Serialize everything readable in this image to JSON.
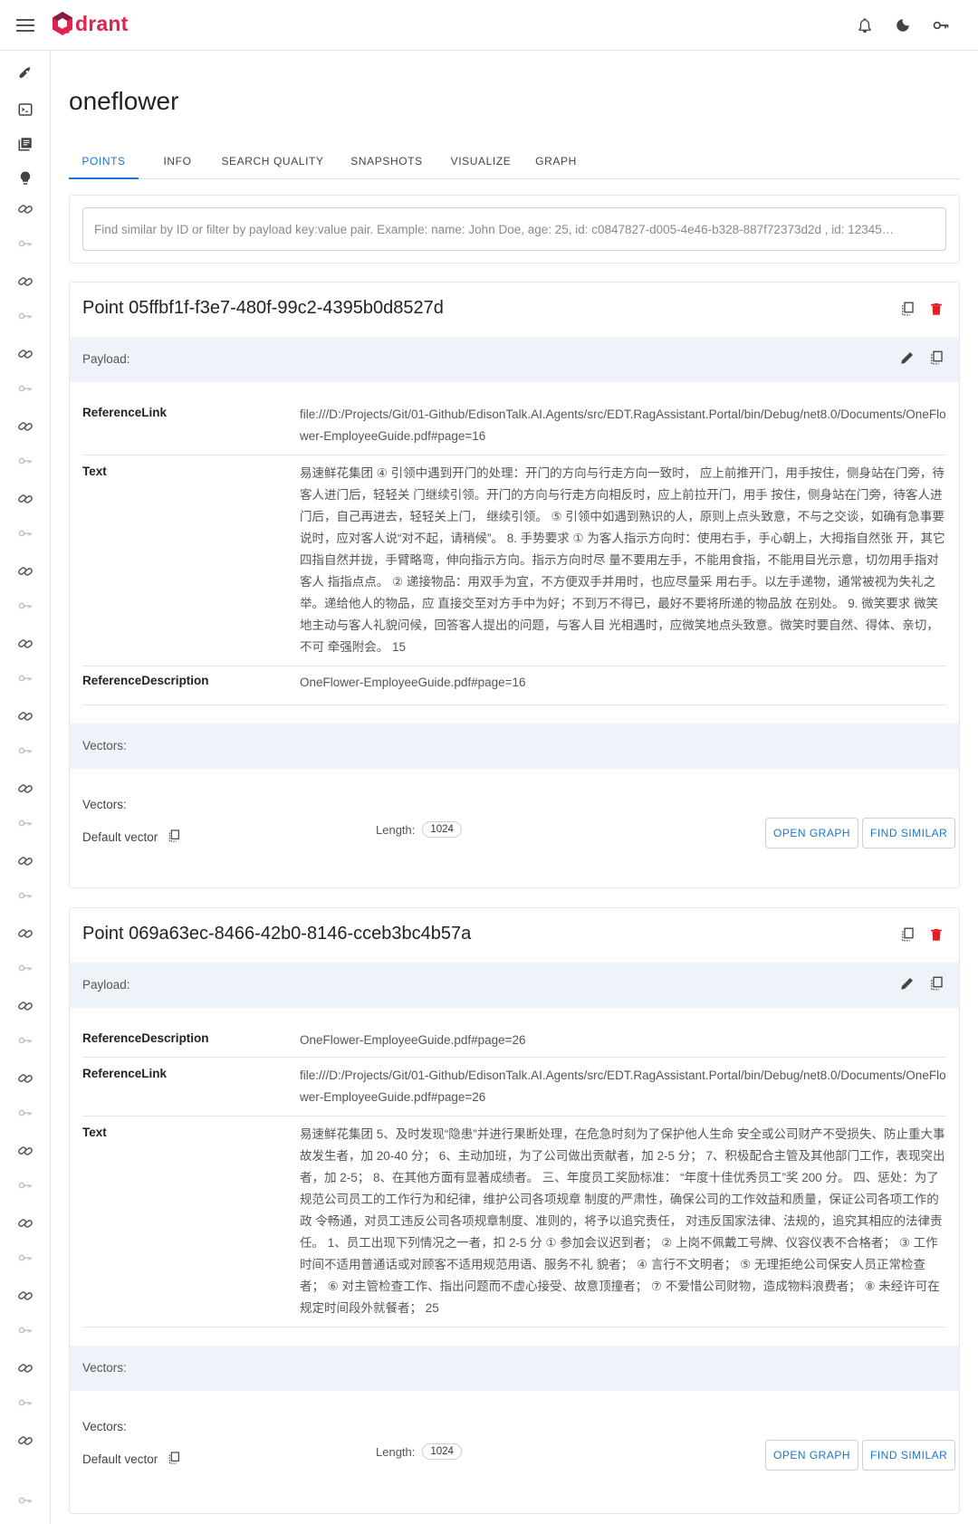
{
  "app": {
    "name": "drant",
    "logo_letter": "Q"
  },
  "collection": {
    "title": "oneflower"
  },
  "tabs": [
    {
      "label": "POINTS",
      "active": true
    },
    {
      "label": "INFO",
      "active": false
    },
    {
      "label": "SEARCH QUALITY",
      "active": false
    },
    {
      "label": "SNAPSHOTS",
      "active": false
    },
    {
      "label": "VISUALIZE",
      "active": false
    },
    {
      "label": "GRAPH",
      "active": false
    }
  ],
  "search": {
    "placeholder": "Find similar by ID or filter by payload key:value pair. Example: name: John Doe, age: 25, id: c0847827-d005-4e46-b328-887f72373d2d , id: 12345…"
  },
  "labels": {
    "payload": "Payload:",
    "vectors_band": "Vectors:",
    "vectors": "Vectors:",
    "default_vector": "Default vector",
    "length": "Length:",
    "open_graph": "OPEN GRAPH",
    "find_similar": "FIND SIMILAR"
  },
  "points": [
    {
      "title": "Point 05ffbf1f-f3e7-480f-99c2-4395b0d8527d",
      "payload": [
        {
          "key": "ReferenceLink",
          "value": "file:///D:/Projects/Git/01-Github/EdisonTalk.AI.Agents/src/EDT.RagAssistant.Portal/bin/Debug/net8.0/Documents/OneFlower-EmployeeGuide.pdf#page=16"
        },
        {
          "key": "Text",
          "value": "易速鲜花集团 ④ 引领中遇到开门的处理：开门的方向与行走方向一致时， 应上前推开门，用手按住，侧身站在门旁，待客人进门后，轻轻关 门继续引领。开门的方向与行走方向相反时，应上前拉开门，用手 按住，侧身站在门旁，待客人进门后，自己再进去，轻轻关上门， 继续引领。 ⑤ 引领中如遇到熟识的人，原则上点头致意，不与之交谈，如确有急事要说时，应对客人说“对不起，请稍候”。 8. 手势要求 ① 为客人指示方向时：使用右手，手心朝上，大拇指自然张 开，其它四指自然并拢，手臂略弯，伸向指示方向。指示方向时尽 量不要用左手，不能用食指，不能用目光示意，切勿用手指对客人 指指点点。 ② 递接物品：用双手为宜，不方便双手并用时，也应尽量采 用右手。以左手递物，通常被视为失礼之举。递给他人的物品，应 直接交至对方手中为好；不到万不得已，最好不要将所递的物品放 在别处。 9. 微笑要求 微笑地主动与客人礼貌问候，回答客人提出的问题，与客人目 光相遇时，应微笑地点头致意。微笑时要自然、得体、亲切，不可 牵强附会。 15"
        },
        {
          "key": "ReferenceDescription",
          "value": "OneFlower-EmployeeGuide.pdf#page=16"
        }
      ],
      "vector_length": "1024"
    },
    {
      "title": "Point 069a63ec-8466-42b0-8146-cceb3bc4b57a",
      "payload": [
        {
          "key": "ReferenceDescription",
          "value": "OneFlower-EmployeeGuide.pdf#page=26"
        },
        {
          "key": "ReferenceLink",
          "value": "file:///D:/Projects/Git/01-Github/EdisonTalk.AI.Agents/src/EDT.RagAssistant.Portal/bin/Debug/net8.0/Documents/OneFlower-EmployeeGuide.pdf#page=26"
        },
        {
          "key": "Text",
          "value": "易速鲜花集团 5、及时发现“隐患”并进行果断处理，在危急时刻为了保护他人生命 安全或公司财产不受损失、防止重大事故发生者，加 20-40 分； 6、主动加班，为了公司做出贡献者，加 2-5 分； 7、积极配合主管及其他部门工作，表现突出者，加 2-5； 8、在其他方面有显著成绩者。 三、年度员工奖励标准： “年度十佳优秀员工”奖 200 分。 四、惩处：为了规范公司员工的工作行为和纪律，维护公司各项规章 制度的严肃性，确保公司的工作效益和质量，保证公司各项工作的政 令畅通，对员工违反公司各项规章制度、准则的，将予以追究责任， 对违反国家法律、法规的，追究其相应的法律责任。 1、员工出现下列情况之一者，扣 2-5 分 ① 参加会议迟到者； ② 上岗不佩戴工号牌、仪容仪表不合格者； ③ 工作时间不适用普通话或对顾客不适用规范用语、服务不礼 貌者； ④ 言行不文明者； ⑤ 无理拒绝公司保安人员正常检查者； ⑥ 对主管检查工作、指出问题而不虚心接受、故意顶撞者； ⑦ 不爱惜公司财物，造成物料浪费者； ⑧ 未经许可在规定时间段外就餐者； 25"
        }
      ],
      "vector_length": "1024"
    }
  ],
  "colors": {
    "brand_red": "#dc244c",
    "accent_blue": "#1976d2",
    "delete_red": "#e31e24",
    "band_bg": "#eef3f9"
  }
}
